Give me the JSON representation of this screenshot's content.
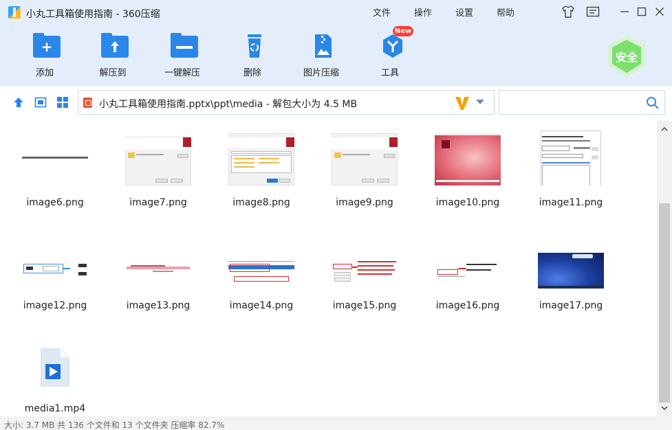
{
  "window": {
    "title": "小丸工具箱使用指南 - 360压缩"
  },
  "menu": {
    "file": "文件",
    "operate": "操作",
    "settings": "设置",
    "help": "帮助"
  },
  "toolbar": {
    "add": "添加",
    "extract_to": "解压到",
    "one_click": "一键解压",
    "delete": "删除",
    "image_compress": "图片压缩",
    "tools": "工具",
    "new_badge": "New"
  },
  "security": {
    "label": "安全"
  },
  "address": {
    "path": "小丸工具箱使用指南.pptx\\ppt\\media - 解包大小为 4.5 MB"
  },
  "search": {
    "placeholder": ""
  },
  "files": [
    {
      "name": "image6.png"
    },
    {
      "name": "image7.png"
    },
    {
      "name": "image8.png"
    },
    {
      "name": "image9.png"
    },
    {
      "name": "image10.png"
    },
    {
      "name": "image11.png"
    },
    {
      "name": "image12.png"
    },
    {
      "name": "image13.png"
    },
    {
      "name": "image14.png"
    },
    {
      "name": "image15.png"
    },
    {
      "name": "image16.png"
    },
    {
      "name": "image17.png"
    },
    {
      "name": "media1.mp4"
    }
  ],
  "status": {
    "text": "大小: 3.7 MB 共 136 个文件和 13 个文件夹 压缩率 82.7%"
  },
  "colors": {
    "accent": "#2a86e8",
    "header_bg": "#e4eefa",
    "shield": "#7be06e"
  }
}
